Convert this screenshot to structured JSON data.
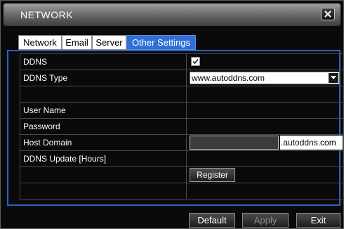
{
  "window": {
    "title": "NETWORK"
  },
  "tabs": [
    {
      "label": "Network",
      "active": false
    },
    {
      "label": "Email",
      "active": false
    },
    {
      "label": "Server",
      "active": false
    },
    {
      "label": "Other Settings",
      "active": true
    }
  ],
  "form": {
    "ddns_label": "DDNS",
    "ddns_enabled": true,
    "ddns_type_label": "DDNS Type",
    "ddns_type_value": "www.autoddns.com",
    "user_name_label": "User Name",
    "password_label": "Password",
    "host_domain_label": "Host Domain",
    "host_domain_value": "",
    "host_domain_suffix": ".autoddns.com",
    "update_label": "DDNS Update [Hours]",
    "register_label": "Register"
  },
  "footer": {
    "default_label": "Default",
    "apply_label": "Apply",
    "apply_enabled": false,
    "exit_label": "Exit"
  },
  "colors": {
    "accent": "#2f6fd6",
    "panel_border": "#2f62c4",
    "background": "#0a0a0a"
  }
}
